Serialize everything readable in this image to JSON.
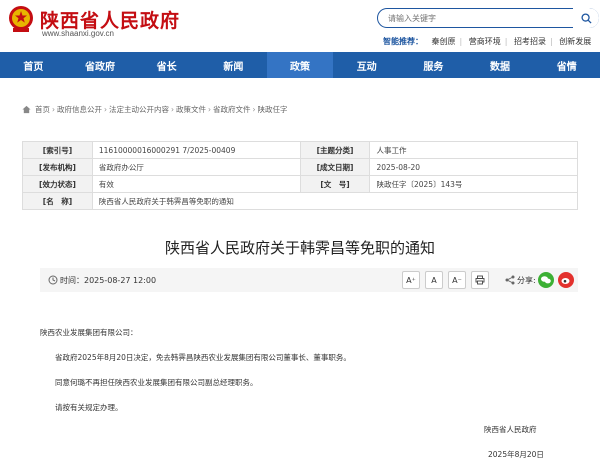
{
  "header": {
    "site_title": "陕西省人民政府",
    "site_url": "www.shaanxi.gov.cn",
    "search_placeholder": "请输入关键字",
    "smart_label": "智能推荐：",
    "smart_items": [
      "秦创原",
      "营商环境",
      "招考招录",
      "创新发展"
    ]
  },
  "nav": {
    "items": [
      "首页",
      "省政府",
      "省长",
      "新闻",
      "政策",
      "互动",
      "服务",
      "数据",
      "省情"
    ],
    "active_index": 4
  },
  "breadcrumb": [
    "首页",
    "政府信息公开",
    "法定主动公开内容",
    "政策文件",
    "省政府文件",
    "陕政任字"
  ],
  "meta": {
    "rows": [
      [
        {
          "k": "[索引号]",
          "v": "11610000016000291 7/2025-00409"
        },
        {
          "k": "[主题分类]",
          "v": "人事工作"
        }
      ],
      [
        {
          "k": "[发布机构]",
          "v": "省政府办公厅"
        },
        {
          "k": "[成文日期]",
          "v": "2025-08-20"
        }
      ],
      [
        {
          "k": "[效力状态]",
          "v": "有效"
        },
        {
          "k": "[文　号]",
          "v": "陕政任字〔2025〕143号"
        }
      ]
    ],
    "name_key": "[名　称]",
    "name_value": "陕西省人民政府关于韩霁昌等免职的通知"
  },
  "document": {
    "title": "陕西省人民政府关于韩霁昌等免职的通知",
    "time_label": "时间：",
    "time_value": "2025-08-27 12:00",
    "share_label": "分享:",
    "font_buttons": [
      "A⁺",
      "A",
      "A⁻"
    ],
    "salutation": "陕西农业发展集团有限公司：",
    "paragraphs": [
      "省政府2025年8月20日决定，免去韩霁昌陕西农业发展集团有限公司董事长、董事职务。",
      "同意何璐不再担任陕西农业发展集团有限公司副总经理职务。",
      "请按有关规定办理。"
    ],
    "signer": "陕西省人民政府",
    "sign_date": "2025年8月20日"
  },
  "colors": {
    "brand_red": "#c40d12",
    "nav_blue": "#1f5ea8",
    "nav_active": "#3474c4",
    "wechat_green": "#3cb034",
    "weibo_red": "#e3312d"
  }
}
